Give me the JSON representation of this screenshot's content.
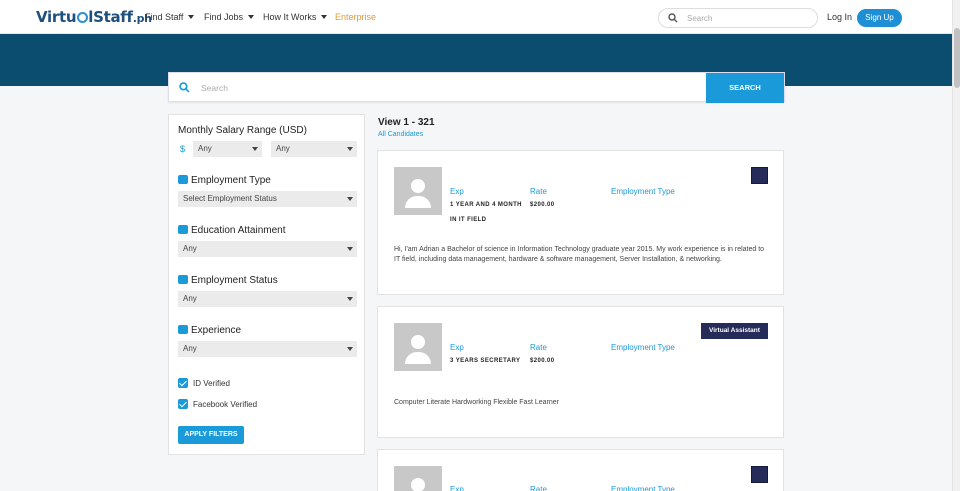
{
  "nav": {
    "logo_part1": "Virtu",
    "logo_part2": "lStaff",
    "logo_suffix": ".ph",
    "menu": [
      "Find Staff",
      "Find Jobs",
      "How It Works",
      "Enterprise"
    ],
    "search_placeholder": "Search",
    "login": "Log In",
    "signup": "Sign Up"
  },
  "hero": {
    "search_placeholder": "Search",
    "search_button": "SEARCH"
  },
  "filters": {
    "salary_title": "Monthly Salary Range (USD)",
    "currency": "$",
    "salary_min": "Any",
    "salary_max": "Any",
    "employment_type_title": "Employment Type",
    "employment_type_value": "Select Employment Status",
    "education_title": "Education Attainment",
    "education_value": "Any",
    "employment_status_title": "Employment Status",
    "employment_status_value": "Any",
    "experience_title": "Experience",
    "experience_value": "Any",
    "id_verified": "ID Verified",
    "facebook_verified": "Facebook Verified",
    "apply_button": "APPLY FILTERS"
  },
  "results": {
    "view_title": "View 1 - 321",
    "all_candidates": "All Candidates",
    "labels": {
      "exp": "Exp",
      "rate": "Rate",
      "employment_type": "Employment Type"
    },
    "cards": [
      {
        "exp_line1": "1 YEAR AND 4 MONTH",
        "exp_line2": "IN IT FIELD",
        "rate": "$200.00",
        "description": "Hi, I'am Adrian a Bachelor of science in Information Technology graduate year 2015. My work experience is in related to IT field, including data management, hardware & software management, Server Installation, & networking."
      },
      {
        "exp_line1": "3 YEARS SECRETARY",
        "rate": "$200.00",
        "badge": "Virtual Assistant",
        "description": "Computer Literate Hardworking Flexible Fast Learner"
      }
    ]
  },
  "colors": {
    "primary": "#1a9ad8",
    "hero": "#0a4d6e",
    "badge": "#252c5a",
    "enterprise": "#e39a3b"
  }
}
